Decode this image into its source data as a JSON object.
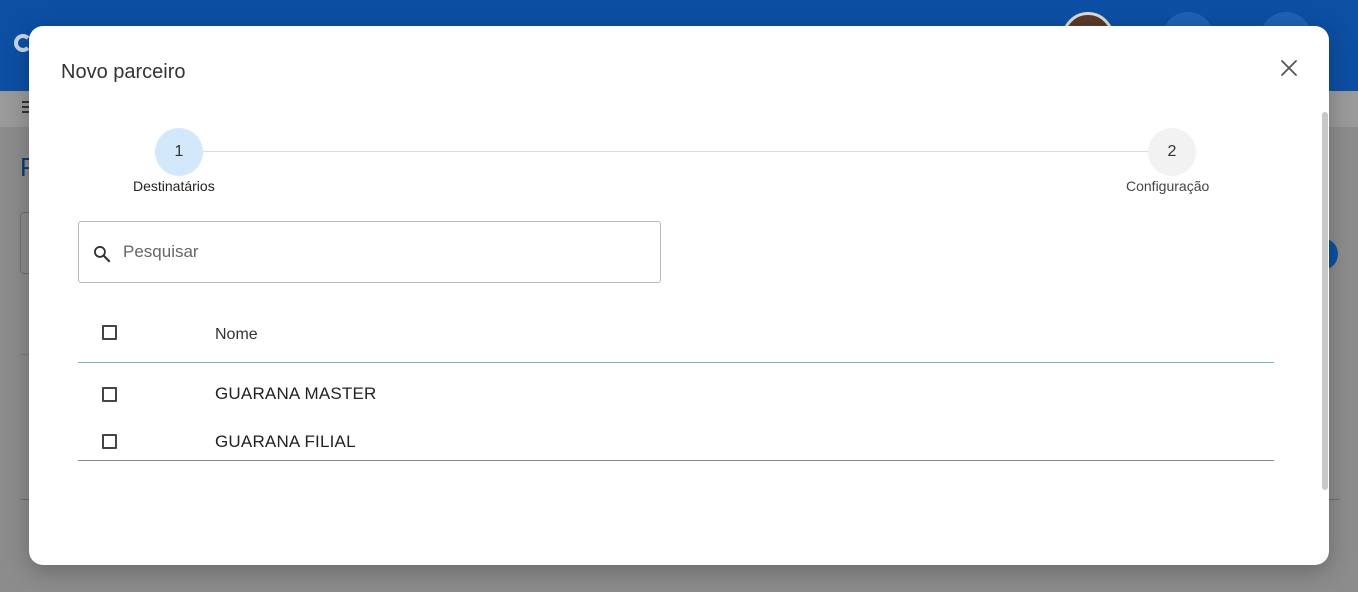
{
  "modal": {
    "title": "Novo parceiro"
  },
  "stepper": {
    "steps": [
      {
        "number": "1",
        "label": "Destinatários",
        "state": "active"
      },
      {
        "number": "2",
        "label": "Configuração",
        "state": "inactive"
      }
    ]
  },
  "search": {
    "placeholder": "Pesquisar",
    "value": ""
  },
  "table": {
    "columns": [
      "Nome"
    ],
    "rows": [
      {
        "name": "GUARANA MASTER",
        "checked": false
      },
      {
        "name": "GUARANA FILIAL",
        "checked": false
      }
    ]
  },
  "icons": {
    "close": "close-icon",
    "search": "search-icon"
  },
  "colors": {
    "header_blue": "#0d4fa3",
    "active_step": "#d3e8fb",
    "inactive_step": "#f2f2f2"
  },
  "background_app": {
    "title_fragment": "P"
  }
}
